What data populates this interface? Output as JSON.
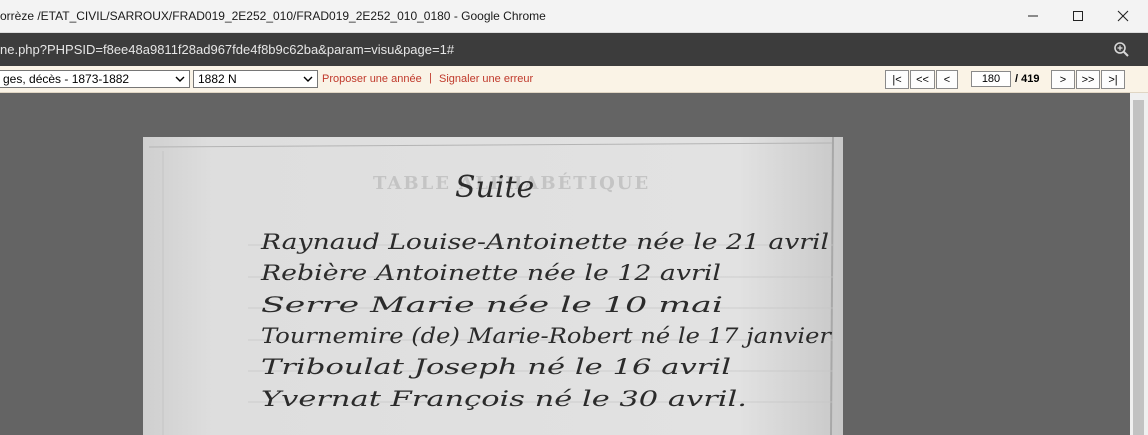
{
  "window": {
    "title": "orrèze /ETAT_CIVIL/SARROUX/FRAD019_2E252_010/FRAD019_2E252_010_0180 - Google Chrome"
  },
  "browser": {
    "url": "ne.php?PHPSID=f8ee48a9811f28ad967fde4f8b9c62ba&param=visu&page=1#"
  },
  "toolbar": {
    "register_select": "ges, décès - 1873-1882",
    "year_select": "1882 N",
    "propose_year": "Proposer une année",
    "separator": "|",
    "report_error": "Signaler une erreur"
  },
  "pager": {
    "first": "|<",
    "prev_many": "<<",
    "prev": "<",
    "current_page": "180",
    "total": "/ 419",
    "next": ">",
    "next_many": ">>",
    "last": ">|"
  },
  "document": {
    "heading": "Suite",
    "faded_heading": "TABLE ALPHABÉTIQUE",
    "lines": [
      "Raynaud Louise-Antoinette née le 21 avril",
      "Rebière Antoinette née le 12 avril",
      "Serre Marie née le 10 mai",
      "Tournemire (de) Marie-Robert né le 17 janvier",
      "Triboulat Joseph né le 16 avril",
      "Yvernat François né le 30 avril."
    ]
  },
  "colors": {
    "link": "#c0392b",
    "toolbar_bg": "#faf3e6",
    "viewer_bg": "#646464",
    "urlbar_bg": "#3c3c3c"
  }
}
